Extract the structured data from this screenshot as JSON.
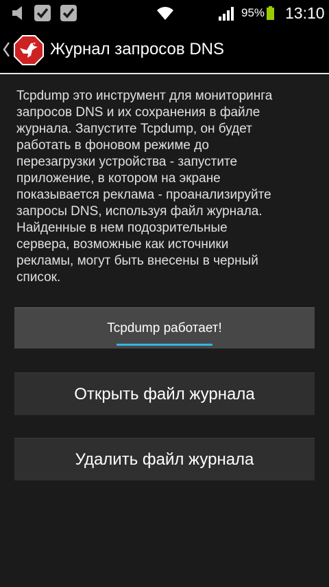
{
  "status_bar": {
    "icons": [
      "volume-muted-icon",
      "checkbox-icon",
      "checkbox-icon",
      "wifi-icon",
      "signal-icon",
      "battery-charging-icon"
    ],
    "battery_percent": "95%",
    "time": "13:10"
  },
  "action_bar": {
    "title": "Журнал запросов DNS",
    "logo": "adblock-bird-logo-icon",
    "accent": "#cc2222"
  },
  "main": {
    "description": "Tcpdump это инструмент для мониторинга\nзапросов DNS и их сохранения в файле\nжурнала. Запустите Tcpdump, он будет\nработать в фоновом режиме до\nперезагрузки устройства - запустите\nприложение, в котором на экране\nпоказывается реклама - проанализируйте\nзапросы DNS, используя файл журнала.\nНайденные в нем подозрительные\nсервера, возможные как источники\nрекламы, могут быть внесены в черный\nсписок.",
    "status_button_label": "Tcpdump работает!",
    "progress_color": "#33b5e5",
    "open_log_label": "Открыть файл журнала",
    "delete_log_label": "Удалить файл журнала"
  }
}
